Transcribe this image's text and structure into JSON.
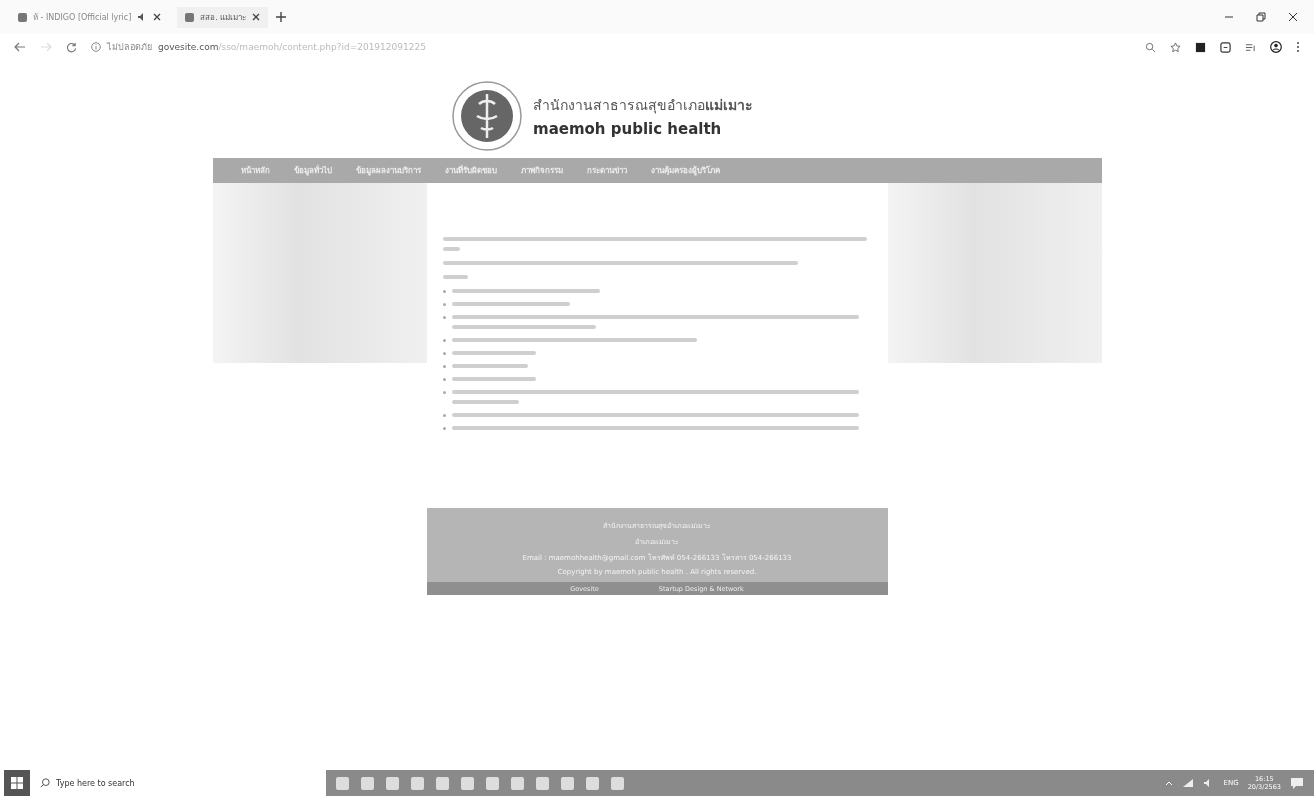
{
  "browser": {
    "tabs": [
      {
        "title": "ห้ - INDIGO [Official lyric]",
        "selected": false,
        "audio": true
      },
      {
        "title": "สสอ. แม่เมาะ",
        "selected": true,
        "audio": false
      }
    ],
    "security_label": "ไม่ปลอดภัย",
    "url_host": "govesite.com",
    "url_path": "/sso/maemoh/content.php?id=201912091225"
  },
  "site": {
    "title": "สำนักงานสาธารณสุขอำเภอ**แม่เมาะ**",
    "subtitle": "maemoh public health"
  },
  "nav": [
    {
      "label": "หน้าหลัก"
    },
    {
      "label": "ข้อมูลทั่วไป"
    },
    {
      "label": "ข้อมูลผลงานบริการ"
    },
    {
      "label": "งานที่รับผิดชอบ"
    },
    {
      "label": "ภาพกิจกรรม"
    },
    {
      "label": "กระดานข่าว"
    },
    {
      "label": "งานคุ้มครองผู้บริโภค"
    }
  ],
  "footer": {
    "lines": [
      "สำนักงานสาธารณสุขอำเภอแม่เมาะ",
      "อำเภอแม่เมาะ",
      "Email : maemohhealth@gmail.com  โทรศัพท์ 054-266133  โทรสาร 054-266133",
      "Copyright by maemoh public health . All rights reserved."
    ],
    "credits": [
      "Govesite",
      "Startup Design & Network"
    ]
  },
  "taskbar": {
    "search_placeholder": "Type here to search",
    "language": "ENG",
    "time": "16:15",
    "date": "20/3/2563"
  }
}
